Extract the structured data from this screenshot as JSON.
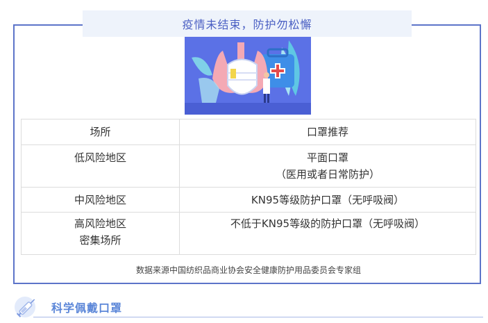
{
  "banner": {
    "text": "疫情未结束，防护勿松懈"
  },
  "illustration": {
    "icon": "mask-lungs-medkit-icon"
  },
  "table": {
    "headers": [
      "场所",
      "口罩推荐"
    ],
    "rows": [
      {
        "place": [
          "低风险地区"
        ],
        "recommend": [
          "平面口罩",
          "（医用或者日常防护）"
        ]
      },
      {
        "place": [
          "中风险地区"
        ],
        "recommend": [
          "KN95等级防护口罩（无呼吸阀）"
        ]
      },
      {
        "place": [
          "高风险地区",
          "密集场所"
        ],
        "recommend": [
          "不低于KN95等级的防护口罩（无呼吸阀）"
        ]
      }
    ]
  },
  "source_note": "数据来源中国纺织品商业协会安全健康防护用品委员会专家组",
  "section": {
    "title": "科学佩戴口罩",
    "icon": "syringe-icon"
  },
  "colors": {
    "accent": "#5c74c9",
    "banner_bg": "#eef3fb",
    "section_title": "#5b86d8"
  }
}
